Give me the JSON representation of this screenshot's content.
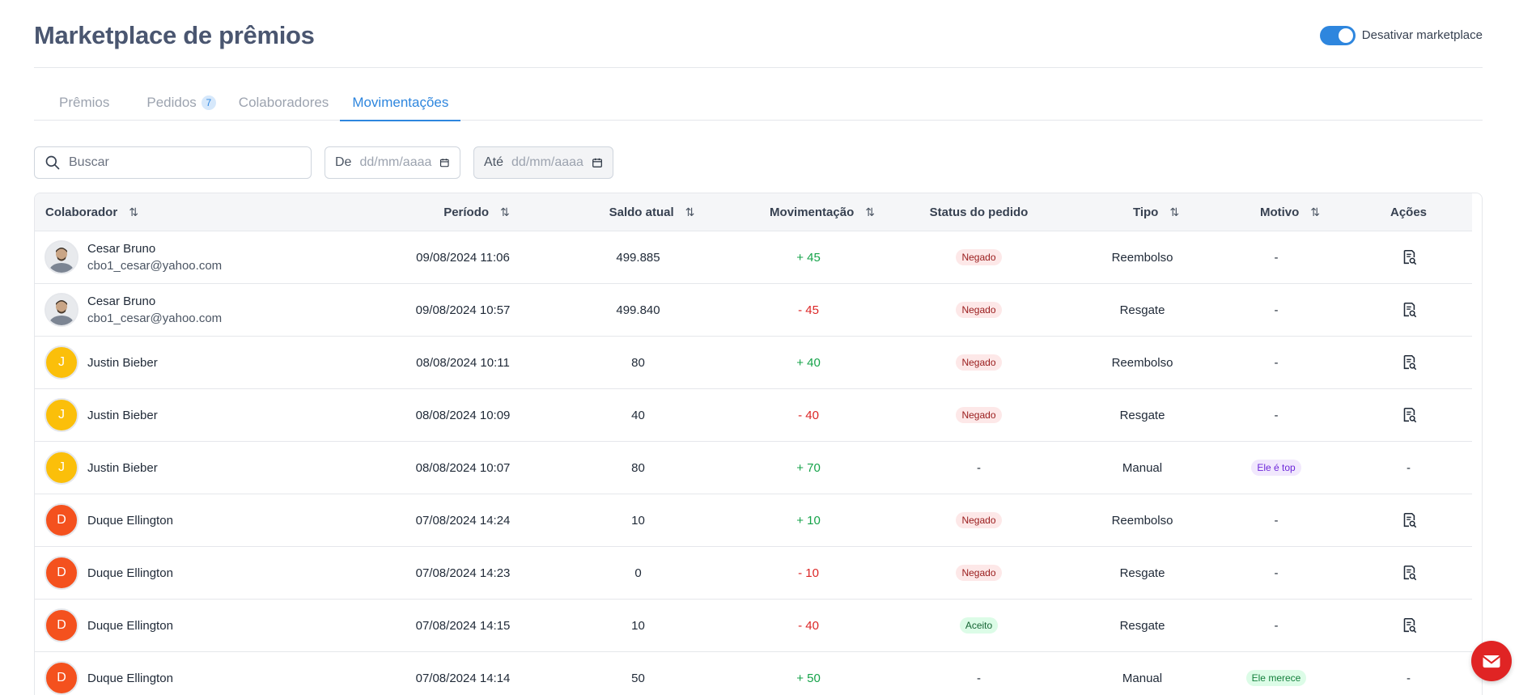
{
  "header": {
    "title": "Marketplace de prêmios",
    "toggle_label": "Desativar marketplace"
  },
  "tabs": [
    {
      "label": "Prêmios"
    },
    {
      "label": "Pedidos",
      "badge": "7"
    },
    {
      "label": "Colaboradores"
    },
    {
      "label": "Movimentações"
    }
  ],
  "filters": {
    "search_placeholder": "Buscar",
    "from_label": "De",
    "to_label": "Até",
    "date_placeholder": "dd/mm/aaaa"
  },
  "table": {
    "headers": {
      "colaborador": "Colaborador",
      "periodo": "Período",
      "saldo": "Saldo atual",
      "movimentacao": "Movimentação",
      "status": "Status do pedido",
      "tipo": "Tipo",
      "motivo": "Motivo",
      "acoes": "Ações"
    },
    "rows": [
      {
        "name": "Cesar Bruno",
        "email": "cbo1_cesar@yahoo.com",
        "initial": "",
        "date": "09/08/2024 11:06",
        "saldo": "499.885",
        "mov": "+ 45",
        "status": "Negado",
        "tipo": "Reembolso",
        "motivo": "-",
        "acao": ""
      },
      {
        "name": "Cesar Bruno",
        "email": "cbo1_cesar@yahoo.com",
        "initial": "",
        "date": "09/08/2024 10:57",
        "saldo": "499.840",
        "mov": "- 45",
        "status": "Negado",
        "tipo": "Resgate",
        "motivo": "-",
        "acao": ""
      },
      {
        "name": "Justin Bieber",
        "email": "",
        "initial": "J",
        "date": "08/08/2024 10:11",
        "saldo": "80",
        "mov": "+ 40",
        "status": "Negado",
        "tipo": "Reembolso",
        "motivo": "-",
        "acao": ""
      },
      {
        "name": "Justin Bieber",
        "email": "",
        "initial": "J",
        "date": "08/08/2024 10:09",
        "saldo": "40",
        "mov": "- 40",
        "status": "Negado",
        "tipo": "Resgate",
        "motivo": "-",
        "acao": ""
      },
      {
        "name": "Justin Bieber",
        "email": "",
        "initial": "J",
        "date": "08/08/2024 10:07",
        "saldo": "80",
        "mov": "+ 70",
        "status": "-",
        "tipo": "Manual",
        "motivo": "Ele é top",
        "acao": "-"
      },
      {
        "name": "Duque Ellington",
        "email": "",
        "initial": "D",
        "date": "07/08/2024 14:24",
        "saldo": "10",
        "mov": "+ 10",
        "status": "Negado",
        "tipo": "Reembolso",
        "motivo": "-",
        "acao": ""
      },
      {
        "name": "Duque Ellington",
        "email": "",
        "initial": "D",
        "date": "07/08/2024 14:23",
        "saldo": "0",
        "mov": "- 10",
        "status": "Negado",
        "tipo": "Resgate",
        "motivo": "-",
        "acao": ""
      },
      {
        "name": "Duque Ellington",
        "email": "",
        "initial": "D",
        "date": "07/08/2024 14:15",
        "saldo": "10",
        "mov": "- 40",
        "status": "Aceito",
        "tipo": "Resgate",
        "motivo": "-",
        "acao": ""
      },
      {
        "name": "Duque Ellington",
        "email": "",
        "initial": "D",
        "date": "07/08/2024 14:14",
        "saldo": "50",
        "mov": "+ 50",
        "status": "-",
        "tipo": "Manual",
        "motivo": "Ele merece",
        "acao": "-"
      }
    ]
  },
  "colors": {
    "accent": "#2e86de",
    "positive": "#16a34a",
    "negative": "#dc2626",
    "fab": "#e02424"
  },
  "icons": {
    "search": "search-icon",
    "calendar": "calendar-icon",
    "sort": "sort-icon",
    "action": "document-search-icon",
    "fab": "mail-icon"
  }
}
